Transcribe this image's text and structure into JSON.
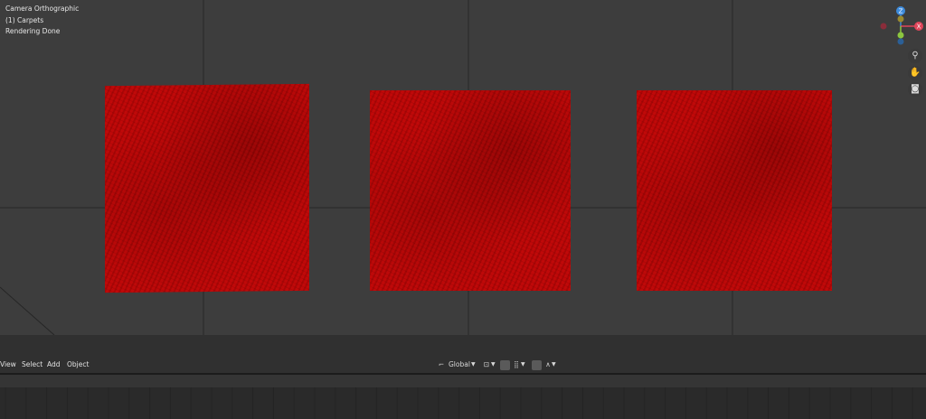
{
  "viewport": {
    "overlay": {
      "view_mode": "Camera Orthographic",
      "collection": "(1) Carpets",
      "status": "Rendering Done"
    },
    "objects": [
      "carpet-1",
      "carpet-2",
      "carpet-3"
    ],
    "carpet_color": "#bd0707"
  },
  "gizmo": {
    "z_label": "Z",
    "x_label": "X",
    "x_color": "#e0455a",
    "y_color": "#8cc63f",
    "z_color": "#3d8bdc"
  },
  "nav_icons": [
    "zoom-icon",
    "hand-pan-icon",
    "camera-icon"
  ],
  "header": {
    "menus": {
      "view": "View",
      "select": "Select",
      "add": "Add",
      "object": "Object"
    },
    "orientation": "Global"
  }
}
